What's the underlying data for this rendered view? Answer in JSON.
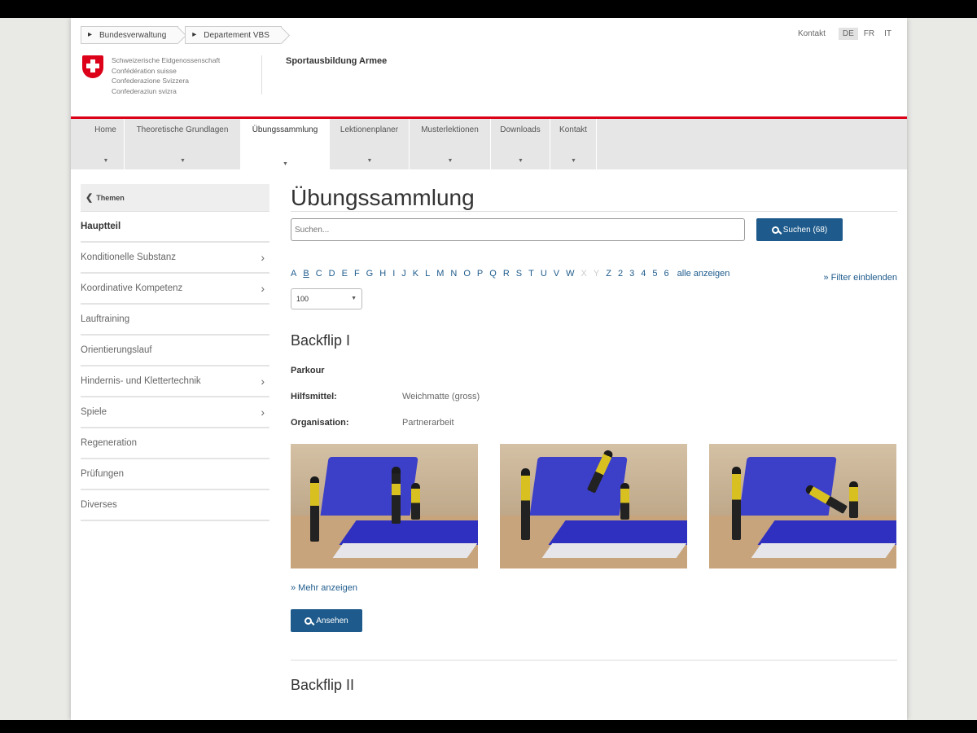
{
  "breadcrumb": [
    "Bundesverwaltung",
    "Departement VBS"
  ],
  "header": {
    "kontakt": "Kontakt",
    "languages": [
      "DE",
      "FR",
      "IT"
    ],
    "active_language": "DE",
    "confederation": [
      "Schweizerische Eidgenossenschaft",
      "Confédération suisse",
      "Confederazione Svizzera",
      "Confederaziun svizra"
    ],
    "site_title": "Sportausbildung Armee"
  },
  "nav": {
    "items": [
      "Home",
      "Theoretische Grundlagen",
      "Übungssammlung",
      "Lektionenplaner",
      "Musterlektionen",
      "Downloads",
      "Kontakt"
    ],
    "active": "Übungssammlung"
  },
  "sidebar": {
    "back": "Themen",
    "current": "Hauptteil",
    "items": [
      {
        "label": "Konditionelle Substanz",
        "has_children": true
      },
      {
        "label": "Koordinative Kompetenz",
        "has_children": true
      },
      {
        "label": "Lauftraining",
        "has_children": false
      },
      {
        "label": "Orientierungslauf",
        "has_children": false
      },
      {
        "label": "Hindernis- und Klettertechnik",
        "has_children": true
      },
      {
        "label": "Spiele",
        "has_children": true
      },
      {
        "label": "Regeneration",
        "has_children": false
      },
      {
        "label": "Prüfungen",
        "has_children": false
      },
      {
        "label": "Diverses",
        "has_children": false
      }
    ]
  },
  "main": {
    "title": "Übungssammlung",
    "search_placeholder": "Suchen...",
    "search_button": "Suchen (68)",
    "filter_link": "» Filter einblenden",
    "alphabet": [
      "A",
      "B",
      "C",
      "D",
      "E",
      "F",
      "G",
      "H",
      "I",
      "J",
      "K",
      "L",
      "M",
      "N",
      "O",
      "P",
      "Q",
      "R",
      "S",
      "T",
      "U",
      "V",
      "W",
      "X",
      "Y",
      "Z",
      "2",
      "3",
      "4",
      "5",
      "6"
    ],
    "alphabet_disabled": [
      "X",
      "Y"
    ],
    "alphabet_selected": "B",
    "show_all": "alle anzeigen",
    "per_page": "100",
    "entries": [
      {
        "title": "Backflip I",
        "category": "Parkour",
        "fields": [
          {
            "label": "Hilfsmittel:",
            "value": "Weichmatte (gross)"
          },
          {
            "label": "Organisation:",
            "value": "Partnerarbeit"
          }
        ],
        "more": "» Mehr anzeigen",
        "view_button": "Ansehen"
      },
      {
        "title": "Backflip II"
      }
    ]
  },
  "colors": {
    "accent": "#1e5b8c",
    "swiss_red": "#dc0018",
    "mat_blue": "#3c3fc8"
  }
}
